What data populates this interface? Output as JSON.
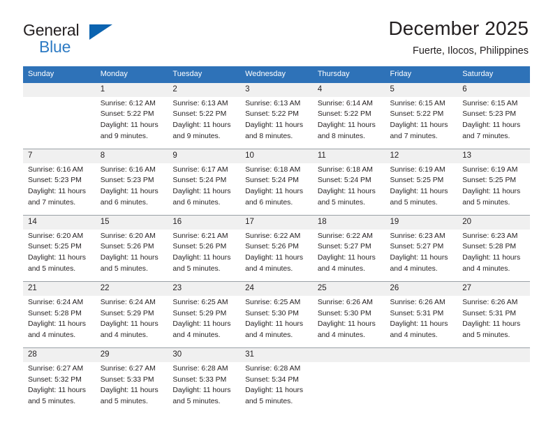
{
  "logo": {
    "word_top": "General",
    "word_bottom": "Blue",
    "triangle_color": "#0b63b0",
    "blue_text_color": "#2e7bc4"
  },
  "header": {
    "title": "December 2025",
    "subtitle": "Fuerte, Ilocos, Philippines"
  },
  "theme": {
    "header_blue": "#2e72b8",
    "daynum_band": "#f0f0f0",
    "rule": "#9aa0a6",
    "text": "#231f20"
  },
  "weekday_headers": [
    "Sunday",
    "Monday",
    "Tuesday",
    "Wednesday",
    "Thursday",
    "Friday",
    "Saturday"
  ],
  "weeks": [
    [
      {
        "day": "",
        "lines": []
      },
      {
        "day": "1",
        "lines": [
          "Sunrise: 6:12 AM",
          "Sunset: 5:22 PM",
          "Daylight: 11 hours",
          "and 9 minutes."
        ]
      },
      {
        "day": "2",
        "lines": [
          "Sunrise: 6:13 AM",
          "Sunset: 5:22 PM",
          "Daylight: 11 hours",
          "and 9 minutes."
        ]
      },
      {
        "day": "3",
        "lines": [
          "Sunrise: 6:13 AM",
          "Sunset: 5:22 PM",
          "Daylight: 11 hours",
          "and 8 minutes."
        ]
      },
      {
        "day": "4",
        "lines": [
          "Sunrise: 6:14 AM",
          "Sunset: 5:22 PM",
          "Daylight: 11 hours",
          "and 8 minutes."
        ]
      },
      {
        "day": "5",
        "lines": [
          "Sunrise: 6:15 AM",
          "Sunset: 5:22 PM",
          "Daylight: 11 hours",
          "and 7 minutes."
        ]
      },
      {
        "day": "6",
        "lines": [
          "Sunrise: 6:15 AM",
          "Sunset: 5:23 PM",
          "Daylight: 11 hours",
          "and 7 minutes."
        ]
      }
    ],
    [
      {
        "day": "7",
        "lines": [
          "Sunrise: 6:16 AM",
          "Sunset: 5:23 PM",
          "Daylight: 11 hours",
          "and 7 minutes."
        ]
      },
      {
        "day": "8",
        "lines": [
          "Sunrise: 6:16 AM",
          "Sunset: 5:23 PM",
          "Daylight: 11 hours",
          "and 6 minutes."
        ]
      },
      {
        "day": "9",
        "lines": [
          "Sunrise: 6:17 AM",
          "Sunset: 5:24 PM",
          "Daylight: 11 hours",
          "and 6 minutes."
        ]
      },
      {
        "day": "10",
        "lines": [
          "Sunrise: 6:18 AM",
          "Sunset: 5:24 PM",
          "Daylight: 11 hours",
          "and 6 minutes."
        ]
      },
      {
        "day": "11",
        "lines": [
          "Sunrise: 6:18 AM",
          "Sunset: 5:24 PM",
          "Daylight: 11 hours",
          "and 5 minutes."
        ]
      },
      {
        "day": "12",
        "lines": [
          "Sunrise: 6:19 AM",
          "Sunset: 5:25 PM",
          "Daylight: 11 hours",
          "and 5 minutes."
        ]
      },
      {
        "day": "13",
        "lines": [
          "Sunrise: 6:19 AM",
          "Sunset: 5:25 PM",
          "Daylight: 11 hours",
          "and 5 minutes."
        ]
      }
    ],
    [
      {
        "day": "14",
        "lines": [
          "Sunrise: 6:20 AM",
          "Sunset: 5:25 PM",
          "Daylight: 11 hours",
          "and 5 minutes."
        ]
      },
      {
        "day": "15",
        "lines": [
          "Sunrise: 6:20 AM",
          "Sunset: 5:26 PM",
          "Daylight: 11 hours",
          "and 5 minutes."
        ]
      },
      {
        "day": "16",
        "lines": [
          "Sunrise: 6:21 AM",
          "Sunset: 5:26 PM",
          "Daylight: 11 hours",
          "and 5 minutes."
        ]
      },
      {
        "day": "17",
        "lines": [
          "Sunrise: 6:22 AM",
          "Sunset: 5:26 PM",
          "Daylight: 11 hours",
          "and 4 minutes."
        ]
      },
      {
        "day": "18",
        "lines": [
          "Sunrise: 6:22 AM",
          "Sunset: 5:27 PM",
          "Daylight: 11 hours",
          "and 4 minutes."
        ]
      },
      {
        "day": "19",
        "lines": [
          "Sunrise: 6:23 AM",
          "Sunset: 5:27 PM",
          "Daylight: 11 hours",
          "and 4 minutes."
        ]
      },
      {
        "day": "20",
        "lines": [
          "Sunrise: 6:23 AM",
          "Sunset: 5:28 PM",
          "Daylight: 11 hours",
          "and 4 minutes."
        ]
      }
    ],
    [
      {
        "day": "21",
        "lines": [
          "Sunrise: 6:24 AM",
          "Sunset: 5:28 PM",
          "Daylight: 11 hours",
          "and 4 minutes."
        ]
      },
      {
        "day": "22",
        "lines": [
          "Sunrise: 6:24 AM",
          "Sunset: 5:29 PM",
          "Daylight: 11 hours",
          "and 4 minutes."
        ]
      },
      {
        "day": "23",
        "lines": [
          "Sunrise: 6:25 AM",
          "Sunset: 5:29 PM",
          "Daylight: 11 hours",
          "and 4 minutes."
        ]
      },
      {
        "day": "24",
        "lines": [
          "Sunrise: 6:25 AM",
          "Sunset: 5:30 PM",
          "Daylight: 11 hours",
          "and 4 minutes."
        ]
      },
      {
        "day": "25",
        "lines": [
          "Sunrise: 6:26 AM",
          "Sunset: 5:30 PM",
          "Daylight: 11 hours",
          "and 4 minutes."
        ]
      },
      {
        "day": "26",
        "lines": [
          "Sunrise: 6:26 AM",
          "Sunset: 5:31 PM",
          "Daylight: 11 hours",
          "and 4 minutes."
        ]
      },
      {
        "day": "27",
        "lines": [
          "Sunrise: 6:26 AM",
          "Sunset: 5:31 PM",
          "Daylight: 11 hours",
          "and 5 minutes."
        ]
      }
    ],
    [
      {
        "day": "28",
        "lines": [
          "Sunrise: 6:27 AM",
          "Sunset: 5:32 PM",
          "Daylight: 11 hours",
          "and 5 minutes."
        ]
      },
      {
        "day": "29",
        "lines": [
          "Sunrise: 6:27 AM",
          "Sunset: 5:33 PM",
          "Daylight: 11 hours",
          "and 5 minutes."
        ]
      },
      {
        "day": "30",
        "lines": [
          "Sunrise: 6:28 AM",
          "Sunset: 5:33 PM",
          "Daylight: 11 hours",
          "and 5 minutes."
        ]
      },
      {
        "day": "31",
        "lines": [
          "Sunrise: 6:28 AM",
          "Sunset: 5:34 PM",
          "Daylight: 11 hours",
          "and 5 minutes."
        ]
      },
      {
        "day": "",
        "lines": []
      },
      {
        "day": "",
        "lines": []
      },
      {
        "day": "",
        "lines": []
      }
    ]
  ]
}
